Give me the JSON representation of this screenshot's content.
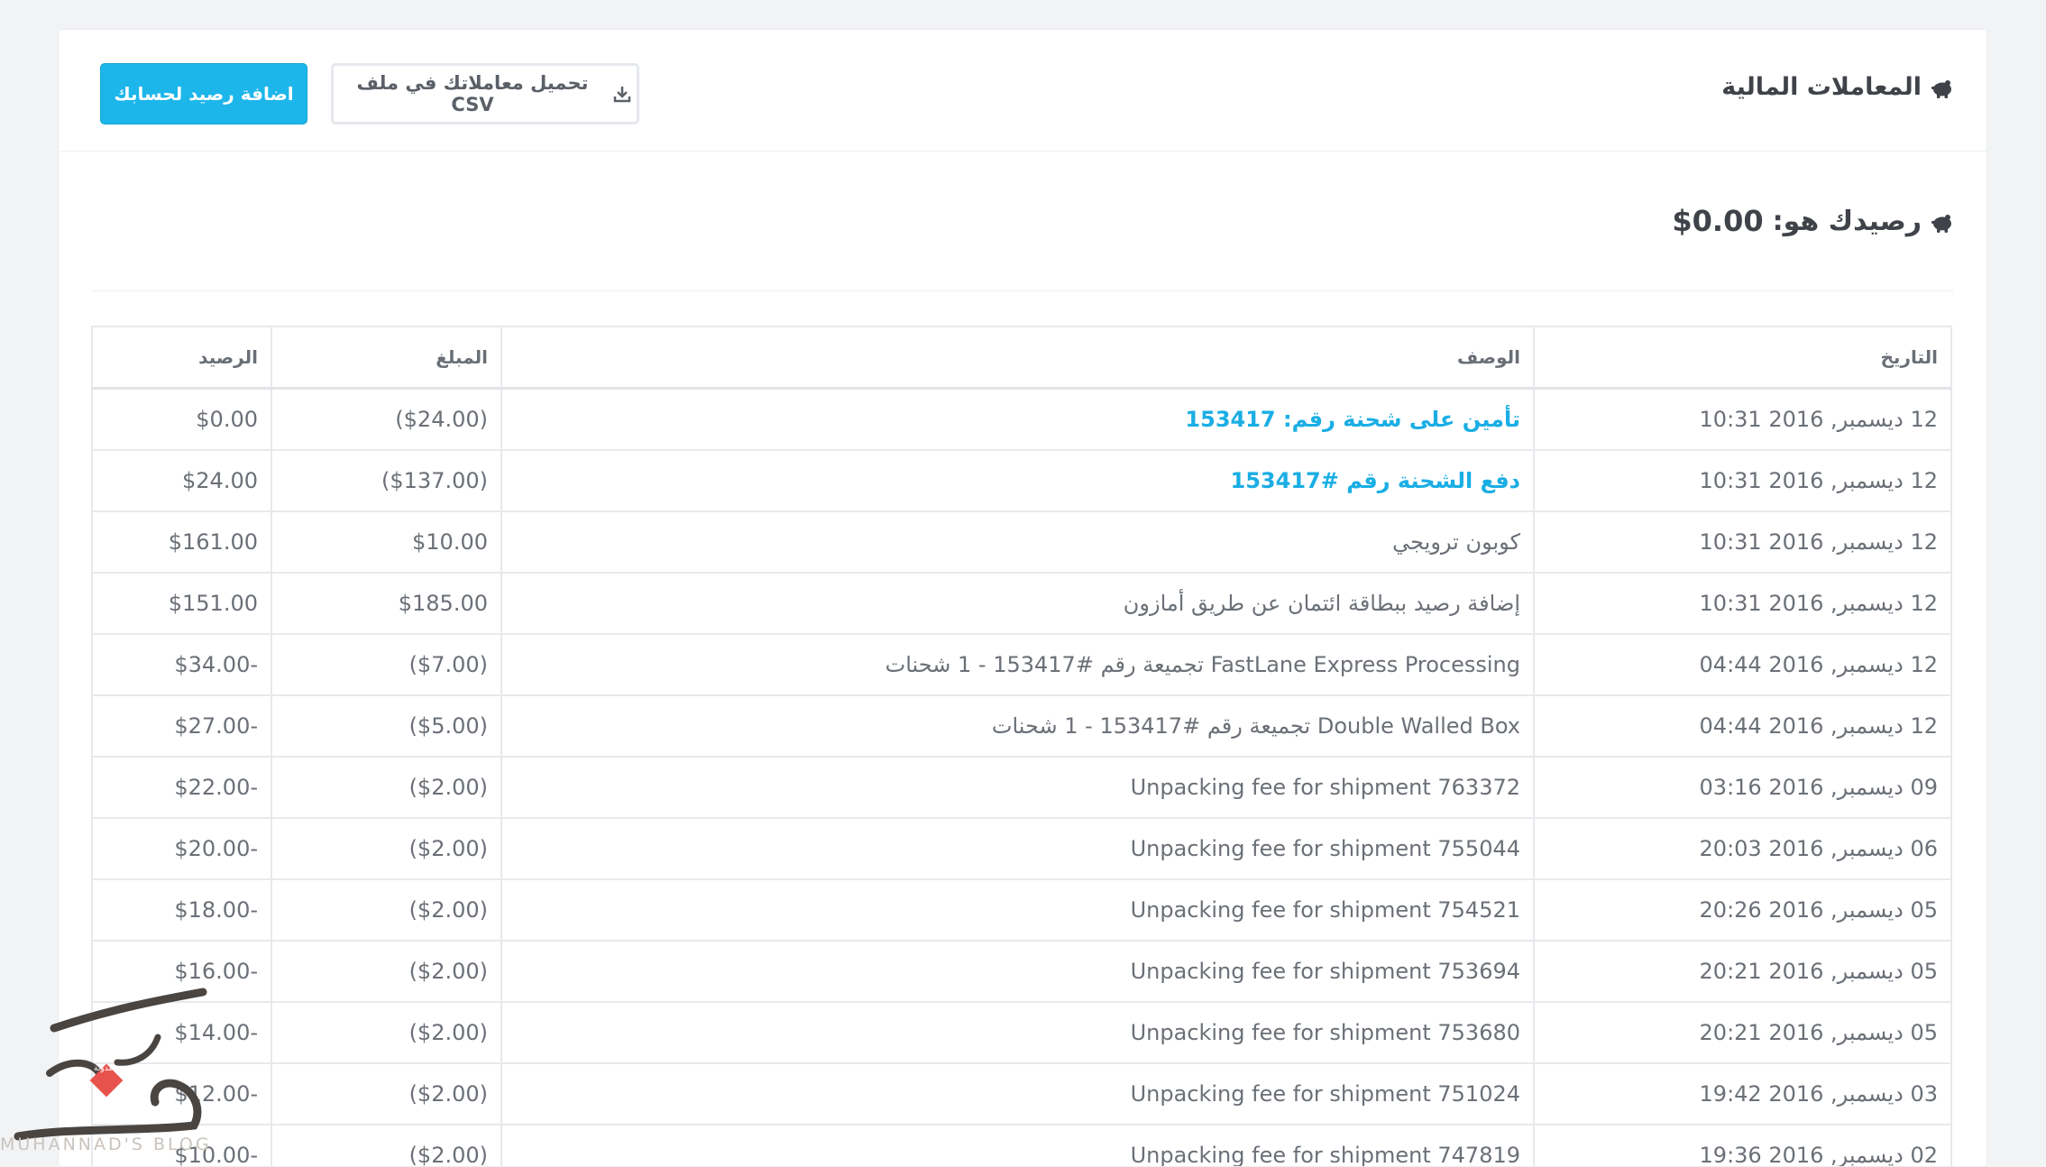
{
  "header": {
    "title": "المعاملات المالية",
    "title_icon": "piggy-bank-icon",
    "add_balance_label": "اضافة رصيد لحسابك",
    "download_csv_label": "تحميل معاملاتك في ملف CSV",
    "download_icon": "download-icon"
  },
  "balance": {
    "label": "رصيدك هو:",
    "amount": "$0.00",
    "icon": "piggy-bank-icon"
  },
  "table": {
    "columns": [
      "التاريخ",
      "الوصف",
      "المبلغ",
      "الرصيد"
    ],
    "rows": [
      {
        "date": "12 ديسمبر, 2016 10:31",
        "desc": "تأمين على شحنة رقم: 153417",
        "link": true,
        "amount": "($24.00)",
        "balance": "$0.00"
      },
      {
        "date": "12 ديسمبر, 2016 10:31",
        "desc": "دفع الشحنة رقم #153417",
        "link": true,
        "amount": "($137.00)",
        "balance": "$24.00"
      },
      {
        "date": "12 ديسمبر, 2016 10:31",
        "desc": "كوبون ترويجي",
        "link": false,
        "amount": "$10.00",
        "balance": "$161.00"
      },
      {
        "date": "12 ديسمبر, 2016 10:31",
        "desc": "إضافة رصيد ببطاقة ائتمان عن طريق أمازون",
        "link": false,
        "amount": "$185.00",
        "balance": "$151.00"
      },
      {
        "date": "12 ديسمبر, 2016 04:44",
        "desc": "FastLane Express Processing تجميعة رقم #153417 - 1 شحنات",
        "link": false,
        "amount": "($7.00)",
        "balance": "$34.00-"
      },
      {
        "date": "12 ديسمبر, 2016 04:44",
        "desc": "Double Walled Box تجميعة رقم #153417 - 1 شحنات",
        "link": false,
        "amount": "($5.00)",
        "balance": "$27.00-"
      },
      {
        "date": "09 ديسمبر, 2016 03:16",
        "desc": "Unpacking fee for shipment 763372",
        "link": false,
        "amount": "($2.00)",
        "balance": "$22.00-"
      },
      {
        "date": "06 ديسمبر, 2016 20:03",
        "desc": "Unpacking fee for shipment 755044",
        "link": false,
        "amount": "($2.00)",
        "balance": "$20.00-"
      },
      {
        "date": "05 ديسمبر, 2016 20:26",
        "desc": "Unpacking fee for shipment 754521",
        "link": false,
        "amount": "($2.00)",
        "balance": "$18.00-"
      },
      {
        "date": "05 ديسمبر, 2016 20:21",
        "desc": "Unpacking fee for shipment 753694",
        "link": false,
        "amount": "($2.00)",
        "balance": "$16.00-"
      },
      {
        "date": "05 ديسمبر, 2016 20:21",
        "desc": "Unpacking fee for shipment 753680",
        "link": false,
        "amount": "($2.00)",
        "balance": "$14.00-"
      },
      {
        "date": "03 ديسمبر, 2016 19:42",
        "desc": "Unpacking fee for shipment 751024",
        "link": false,
        "amount": "($2.00)",
        "balance": "$12.00-"
      },
      {
        "date": "02 ديسمبر, 2016 19:36",
        "desc": "Unpacking fee for shipment 747819",
        "link": false,
        "amount": "($2.00)",
        "balance": "$10.00-"
      }
    ]
  },
  "watermark": {
    "text": "MUHANNAD'S BLOG",
    "badge": "مدونة"
  },
  "colors": {
    "primary": "#1cb6ea",
    "link": "#1aaee4",
    "text": "#6b7077",
    "heading": "#3f4349",
    "border": "#e7e9ec"
  }
}
